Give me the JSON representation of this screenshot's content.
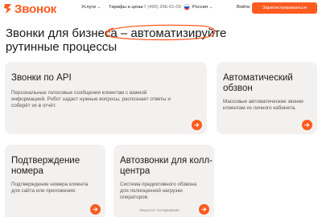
{
  "header": {
    "logo_text": "Звонок",
    "nav_services": "Услуги",
    "nav_tariffs": "Тарифы и цены",
    "phone": "+7 (495) 266-01-09",
    "region": "Россия",
    "login": "Войти",
    "register": "Зарегистрироваться"
  },
  "hero": {
    "title_start": "Звонки для бизнеса – ",
    "title_accent": "автоматизируйте",
    "title_end": "рутинные процессы"
  },
  "cards": [
    {
      "title": "Звонки по API",
      "description": "Персональные голосовые сообщения клиентам с важной информацией. Робот задаст нужные вопросы, распознает ответы и соберёт их в отчёт."
    },
    {
      "title": "Автоматический обзвон",
      "description": "Массовые автоматические звонки клиентам из личного кабинета."
    },
    {
      "title": "Подтверждение номера",
      "description": "Подтверждение номера клиента для сайта или приложения."
    },
    {
      "title": "Автозвонки для колл-центра",
      "description": "Система предиктивного обзвона для полноценной нагрузки операторов.",
      "note": "Закрытое тестирование"
    }
  ],
  "colors": {
    "accent": "#ff5a1f",
    "card_bg": "#f2f1ef"
  },
  "icons": {
    "logo": "logo-mark-icon",
    "arrow": "arrow-right-icon",
    "caret": "chevron-down-icon",
    "flag": "russia-flag-icon"
  }
}
